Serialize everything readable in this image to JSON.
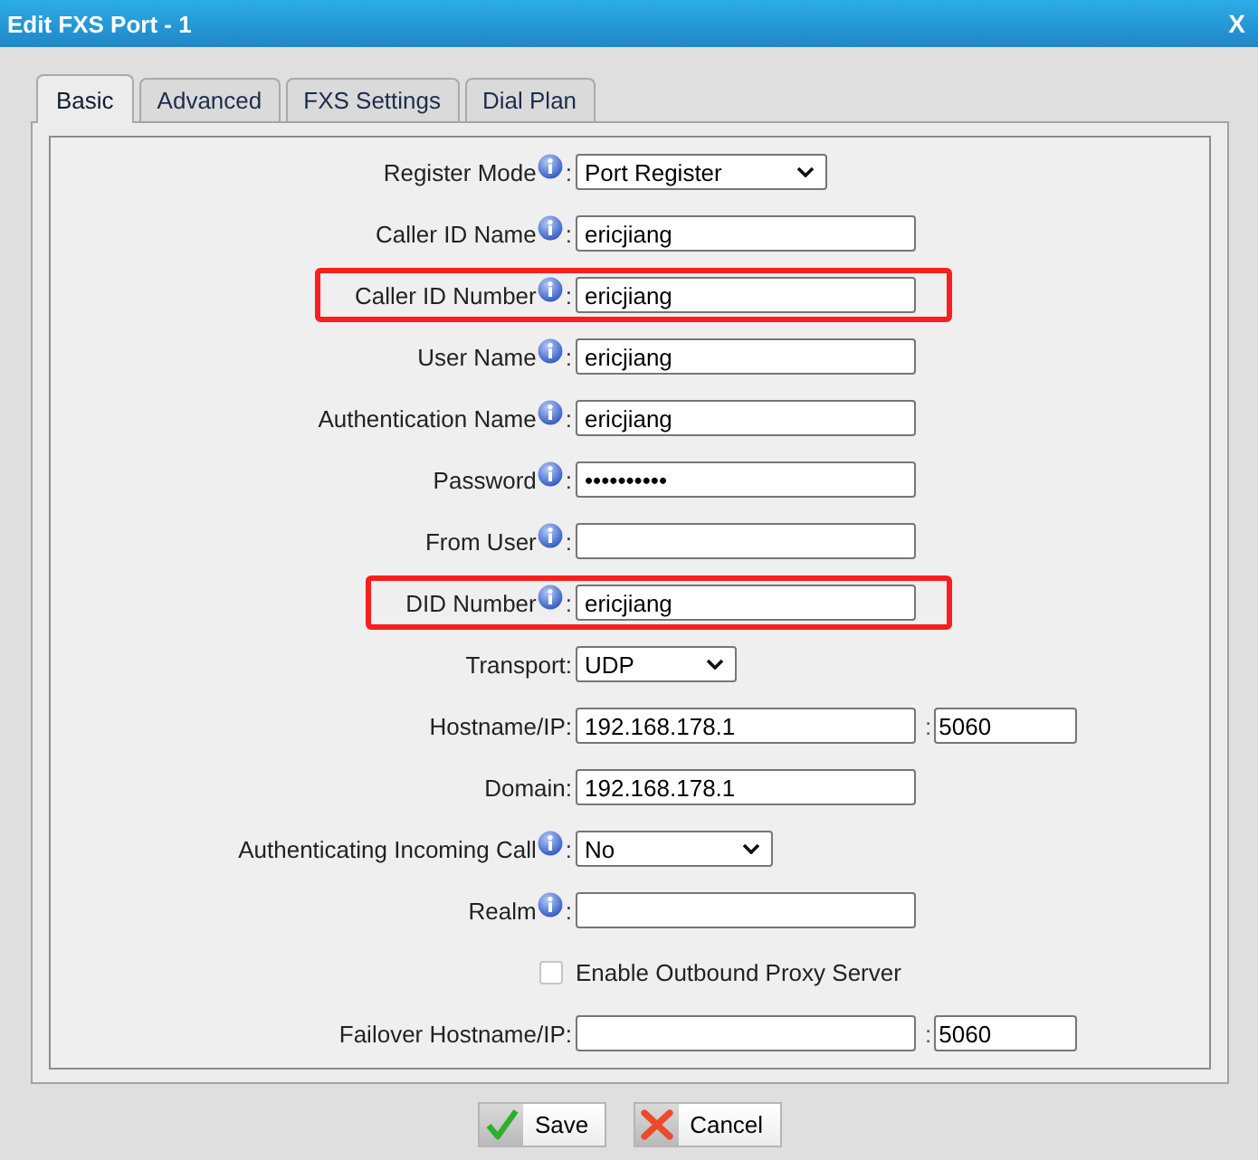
{
  "window": {
    "title": "Edit FXS Port - 1",
    "close": "X"
  },
  "tabs": [
    {
      "label": "Basic",
      "selected": true
    },
    {
      "label": "Advanced",
      "selected": false
    },
    {
      "label": "FXS Settings",
      "selected": false
    },
    {
      "label": "Dial Plan",
      "selected": false
    }
  ],
  "form": {
    "rows": [
      {
        "kind": "select",
        "label": "Register Mode",
        "info": true,
        "colon": ":",
        "value": "Port Register",
        "highlighted": false
      },
      {
        "kind": "text",
        "label": "Caller ID Name",
        "info": true,
        "colon": ":",
        "value": "ericjiang",
        "highlighted": false
      },
      {
        "kind": "text",
        "label": "Caller ID Number",
        "info": true,
        "colon": ":",
        "value": "ericjiang",
        "highlighted": true
      },
      {
        "kind": "text",
        "label": "User Name",
        "info": true,
        "colon": ":",
        "value": "ericjiang",
        "highlighted": false
      },
      {
        "kind": "text",
        "label": "Authentication Name",
        "info": true,
        "colon": ":",
        "value": "ericjiang",
        "highlighted": false
      },
      {
        "kind": "password",
        "label": "Password",
        "info": true,
        "colon": ":",
        "value": "••••••••••",
        "highlighted": false
      },
      {
        "kind": "text",
        "label": "From User",
        "info": true,
        "colon": ":",
        "highlighted": false
      },
      {
        "kind": "text",
        "label": "DID Number",
        "info": true,
        "colon": ":",
        "value": "ericjiang",
        "highlighted": true
      },
      {
        "kind": "select",
        "label": "Transport",
        "info": false,
        "colon": ":",
        "value": "UDP",
        "highlighted": false
      },
      {
        "kind": "text",
        "label": "Hostname/IP",
        "info": false,
        "colon": ":",
        "value": "192.168.178.1",
        "port": {
          "separator": ":",
          "value": "5060"
        },
        "highlighted": false
      },
      {
        "kind": "text",
        "label": "Domain",
        "info": false,
        "colon": ":",
        "value": "192.168.178.1",
        "highlighted": false
      },
      {
        "kind": "select",
        "label": "Authenticating Incoming Call",
        "info": true,
        "colon": ":",
        "value": "No",
        "highlighted": false
      },
      {
        "kind": "text",
        "label": "Realm",
        "info": true,
        "colon": ":",
        "highlighted": false
      },
      {
        "kind": "checkbox",
        "label": "Enable Outbound Proxy Server",
        "checked": false,
        "info": false,
        "highlighted": false
      },
      {
        "kind": "text",
        "label": "Failover Hostname/IP",
        "info": false,
        "colon": ":",
        "port": {
          "separator": ":",
          "value": "5060"
        },
        "highlighted": false
      }
    ]
  },
  "buttons": [
    {
      "kind": "save",
      "label": "Save"
    },
    {
      "kind": "cancel",
      "label": "Cancel"
    }
  ]
}
